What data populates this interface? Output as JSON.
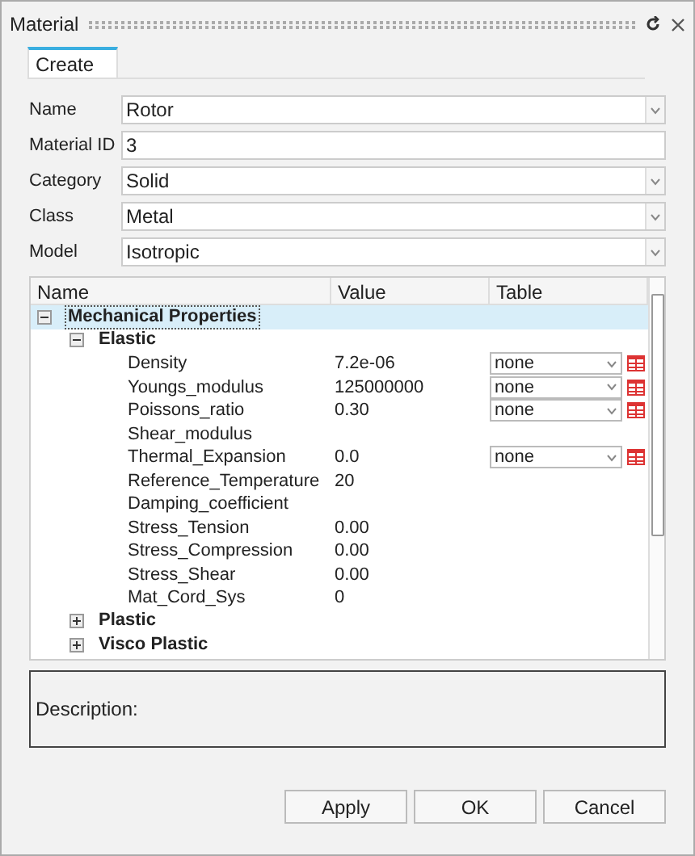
{
  "window": {
    "title": "Material"
  },
  "tabs": [
    {
      "label": "Create",
      "selected": true
    }
  ],
  "fields": [
    {
      "label": "Name",
      "kind": "dropdown",
      "value": "Rotor"
    },
    {
      "label": "Material ID",
      "kind": "text",
      "value": "3"
    },
    {
      "label": "Category",
      "kind": "dropdown",
      "value": "Solid"
    },
    {
      "label": "Class",
      "kind": "dropdown",
      "value": "Metal"
    },
    {
      "label": "Model",
      "kind": "dropdown",
      "value": "Isotropic"
    }
  ],
  "tree": {
    "columns": [
      "Name",
      "Value",
      "Table"
    ],
    "items": [
      {
        "kind": "group",
        "name": "Mechanical Properties",
        "expanded": true,
        "selected": true,
        "children": [
          {
            "kind": "group",
            "name": "Elastic",
            "expanded": true,
            "selected": false,
            "children": [
              {
                "kind": "property",
                "name": "Density",
                "value": "7.2e-06",
                "table": "none"
              },
              {
                "kind": "property",
                "name": "Youngs_modulus",
                "value": "125000000",
                "table": "none"
              },
              {
                "kind": "property",
                "name": "Poissons_ratio",
                "value": "0.30",
                "table": "none"
              },
              {
                "kind": "property",
                "name": "Shear_modulus"
              },
              {
                "kind": "property",
                "name": "Thermal_Expansion",
                "value": "0.0",
                "table": "none"
              },
              {
                "kind": "property",
                "name": "Reference_Temperature",
                "value": "20"
              },
              {
                "kind": "property",
                "name": "Damping_coefficient"
              },
              {
                "kind": "property",
                "name": "Stress_Tension",
                "value": "0.00"
              },
              {
                "kind": "property",
                "name": "Stress_Compression",
                "value": "0.00"
              },
              {
                "kind": "property",
                "name": "Stress_Shear",
                "value": "0.00"
              },
              {
                "kind": "property",
                "name": "Mat_Cord_Sys",
                "value": "0"
              }
            ]
          },
          {
            "kind": "group",
            "name": "Plastic",
            "expanded": false,
            "selected": false
          },
          {
            "kind": "group",
            "name": "Visco Plastic",
            "expanded": false,
            "selected": false
          }
        ]
      }
    ]
  },
  "description": {
    "label": "Description:"
  },
  "buttons": [
    "Apply",
    "OK",
    "Cancel"
  ]
}
